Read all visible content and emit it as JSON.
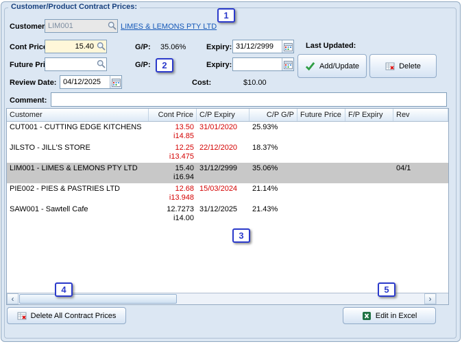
{
  "group_title": "Customer/Product Contract Prices:",
  "form": {
    "customer_label": "Customer:",
    "customer_code": "LIM001",
    "customer_link": "LIMES & LEMONS PTY LTD",
    "cont_price_label": "Cont Price:",
    "cont_price": "15.40",
    "cont_gp_label": "G/P:",
    "cont_gp": "35.06%",
    "cont_expiry_label": "Expiry:",
    "cont_expiry": "31/12/2999",
    "last_updated_label": "Last Updated:",
    "future_price_label": "Future Price:",
    "future_price": "",
    "future_gp_label": "G/P:",
    "future_gp": "",
    "future_expiry_label": "Expiry:",
    "future_expiry": "",
    "review_date_label": "Review Date:",
    "review_date": "04/12/2025",
    "cost_label": "Cost:",
    "cost_value": "$10.00",
    "comment_label": "Comment:",
    "comment": ""
  },
  "buttons": {
    "add_update": "Add/Update",
    "delete": "Delete",
    "delete_all": "Delete All Contract Prices",
    "edit_in_excel": "Edit in Excel"
  },
  "grid": {
    "columns": [
      "Customer",
      "Cont Price",
      "C/P Expiry",
      "C/P G/P",
      "Future Price",
      "F/P Expiry",
      "Rev"
    ],
    "rows": [
      {
        "customer": "CUT001 - CUTTING EDGE KITCHENS",
        "cont_price": "13.50",
        "inc_price": "i14.85",
        "cp_expiry": "31/01/2020",
        "cp_gp": "25.93%",
        "future_price": "",
        "fp_expiry": "",
        "review": "",
        "expired": true,
        "selected": false
      },
      {
        "customer": "JILSTO - JILL'S STORE",
        "cont_price": "12.25",
        "inc_price": "i13.475",
        "cp_expiry": "22/12/2020",
        "cp_gp": "18.37%",
        "future_price": "",
        "fp_expiry": "",
        "review": "",
        "expired": true,
        "selected": false
      },
      {
        "customer": "LIM001 - LIMES & LEMONS PTY LTD",
        "cont_price": "15.40",
        "inc_price": "i16.94",
        "cp_expiry": "31/12/2999",
        "cp_gp": "35.06%",
        "future_price": "",
        "fp_expiry": "",
        "review": "04/1",
        "expired": false,
        "selected": true
      },
      {
        "customer": "PIE002 - PIES & PASTRIES LTD",
        "cont_price": "12.68",
        "inc_price": "i13.948",
        "cp_expiry": "15/03/2024",
        "cp_gp": "21.14%",
        "future_price": "",
        "fp_expiry": "",
        "review": "",
        "expired": true,
        "selected": false
      },
      {
        "customer": "SAW001 - Sawtell Cafe",
        "cont_price": "12.7273",
        "inc_price": "i14.00",
        "cp_expiry": "31/12/2025",
        "cp_gp": "21.43%",
        "future_price": "",
        "fp_expiry": "",
        "review": "",
        "expired": false,
        "selected": false
      }
    ]
  },
  "callouts": {
    "c1": "1",
    "c2": "2",
    "c3": "3",
    "c4": "4",
    "c5": "5"
  }
}
